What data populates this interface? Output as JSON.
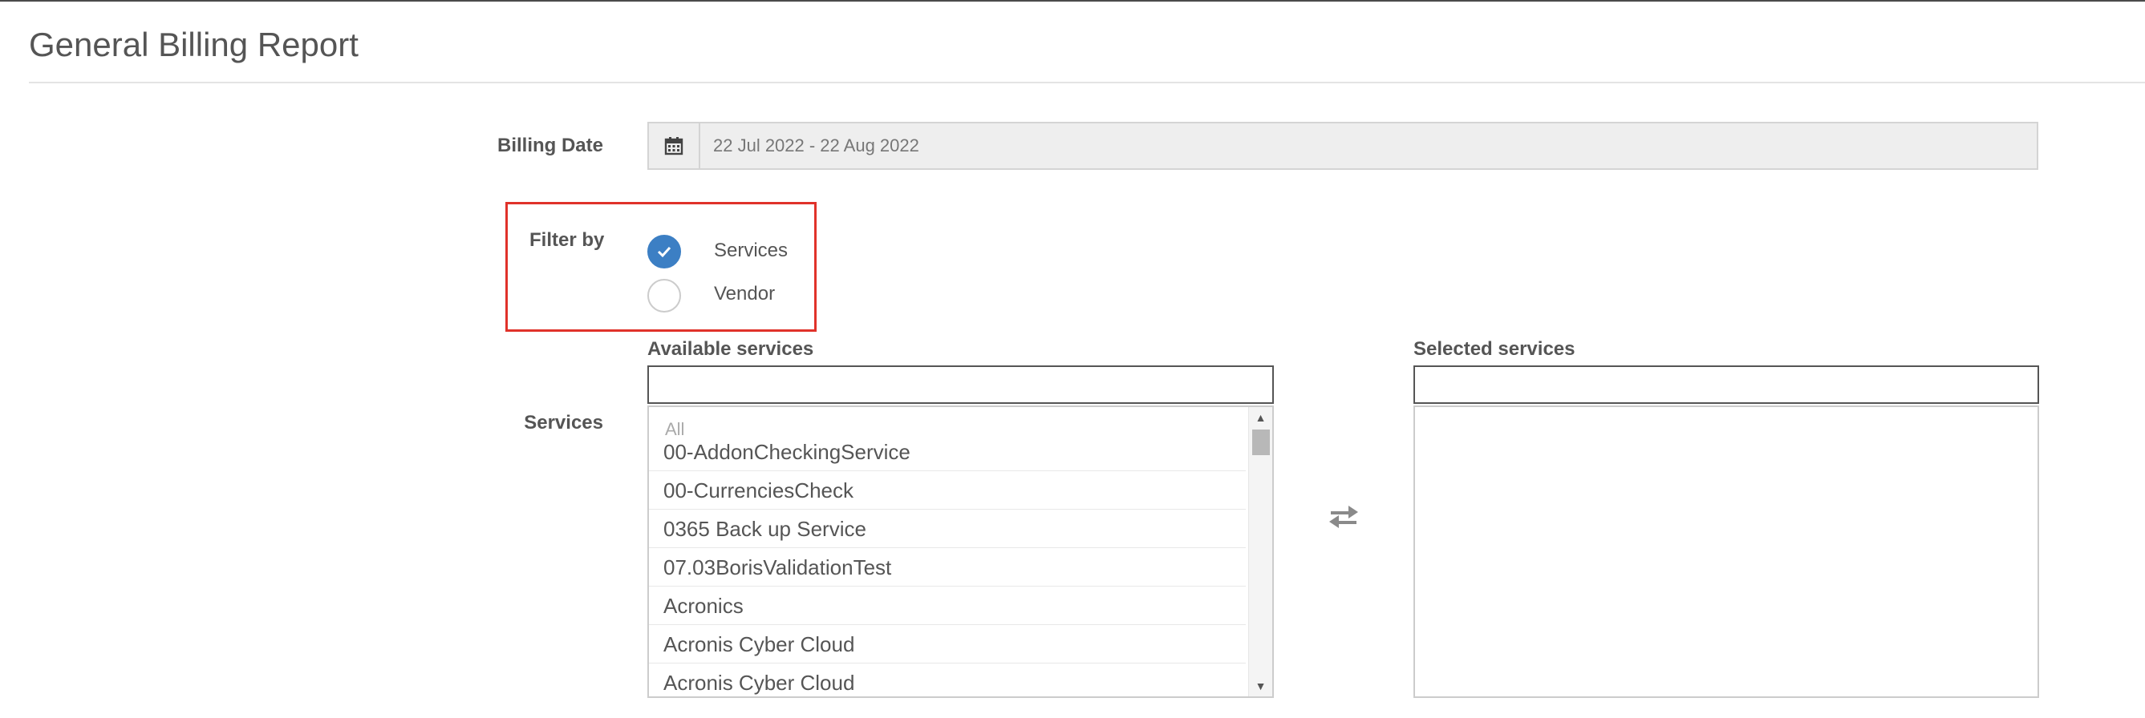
{
  "page": {
    "title": "General Billing Report"
  },
  "billing_date": {
    "label": "Billing Date",
    "value": "22 Jul 2022 - 22 Aug 2022",
    "icon": "calendar-icon"
  },
  "filter": {
    "label": "Filter by",
    "options": [
      {
        "label": "Services",
        "checked": true
      },
      {
        "label": "Vendor",
        "checked": false
      }
    ]
  },
  "services": {
    "label": "Services",
    "available": {
      "title": "Available services",
      "search_value": "",
      "all_label": "All",
      "items": [
        "00-AddonCheckingService",
        "00-CurrenciesCheck",
        "0365 Back up Service",
        "07.03BorisValidationTest",
        "Acronics",
        "Acronis Cyber Cloud",
        "Acronis Cyber Cloud"
      ]
    },
    "selected": {
      "title": "Selected services",
      "search_value": "",
      "items": []
    },
    "transfer_icon": "swap-arrows-icon"
  },
  "colors": {
    "accent": "#3c7fc4",
    "highlight": "#e0322a",
    "text": "#555555"
  }
}
